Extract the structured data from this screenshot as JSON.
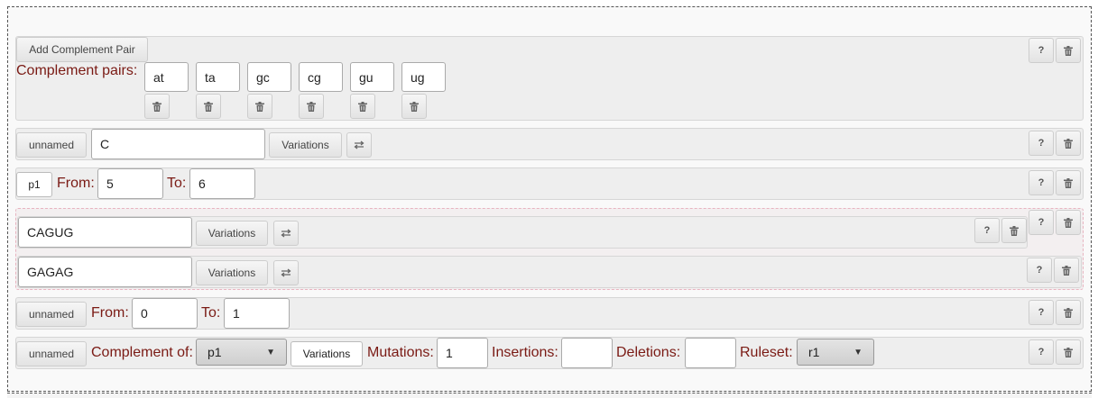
{
  "complement_pairs": {
    "add_button": "Add Complement Pair",
    "label": "Complement pairs:",
    "pairs": [
      "at",
      "ta",
      "gc",
      "cg",
      "gu",
      "ug"
    ]
  },
  "seq_row": {
    "name_button": "unnamed",
    "sequence": "C",
    "variations_button": "Variations"
  },
  "range_row_1": {
    "name_button": "p1",
    "from_label": "From:",
    "from_value": "5",
    "to_label": "To:",
    "to_value": "6"
  },
  "group": {
    "items": [
      {
        "sequence": "CAGUG",
        "variations_button": "Variations"
      },
      {
        "sequence": "GAGAG",
        "variations_button": "Variations"
      }
    ]
  },
  "range_row_2": {
    "name_button": "unnamed",
    "from_label": "From:",
    "from_value": "0",
    "to_label": "To:",
    "to_value": "1"
  },
  "complement_row": {
    "name_button": "unnamed",
    "complement_label": "Complement of:",
    "complement_selected": "p1",
    "variations_button": "Variations",
    "mutations_label": "Mutations:",
    "mutations_value": "1",
    "insertions_label": "Insertions:",
    "insertions_value": "",
    "deletions_label": "Deletions:",
    "deletions_value": "",
    "ruleset_label": "Ruleset:",
    "ruleset_selected": "r1"
  },
  "help_label": "?",
  "icons": {
    "delete": "trash-icon",
    "swap": "swap-arrows-icon",
    "dropdown": "chevron-down-icon"
  },
  "colors": {
    "label": "#7a1a14",
    "row_bg": "#eeeeee",
    "group_border": "#e8b4c0"
  }
}
